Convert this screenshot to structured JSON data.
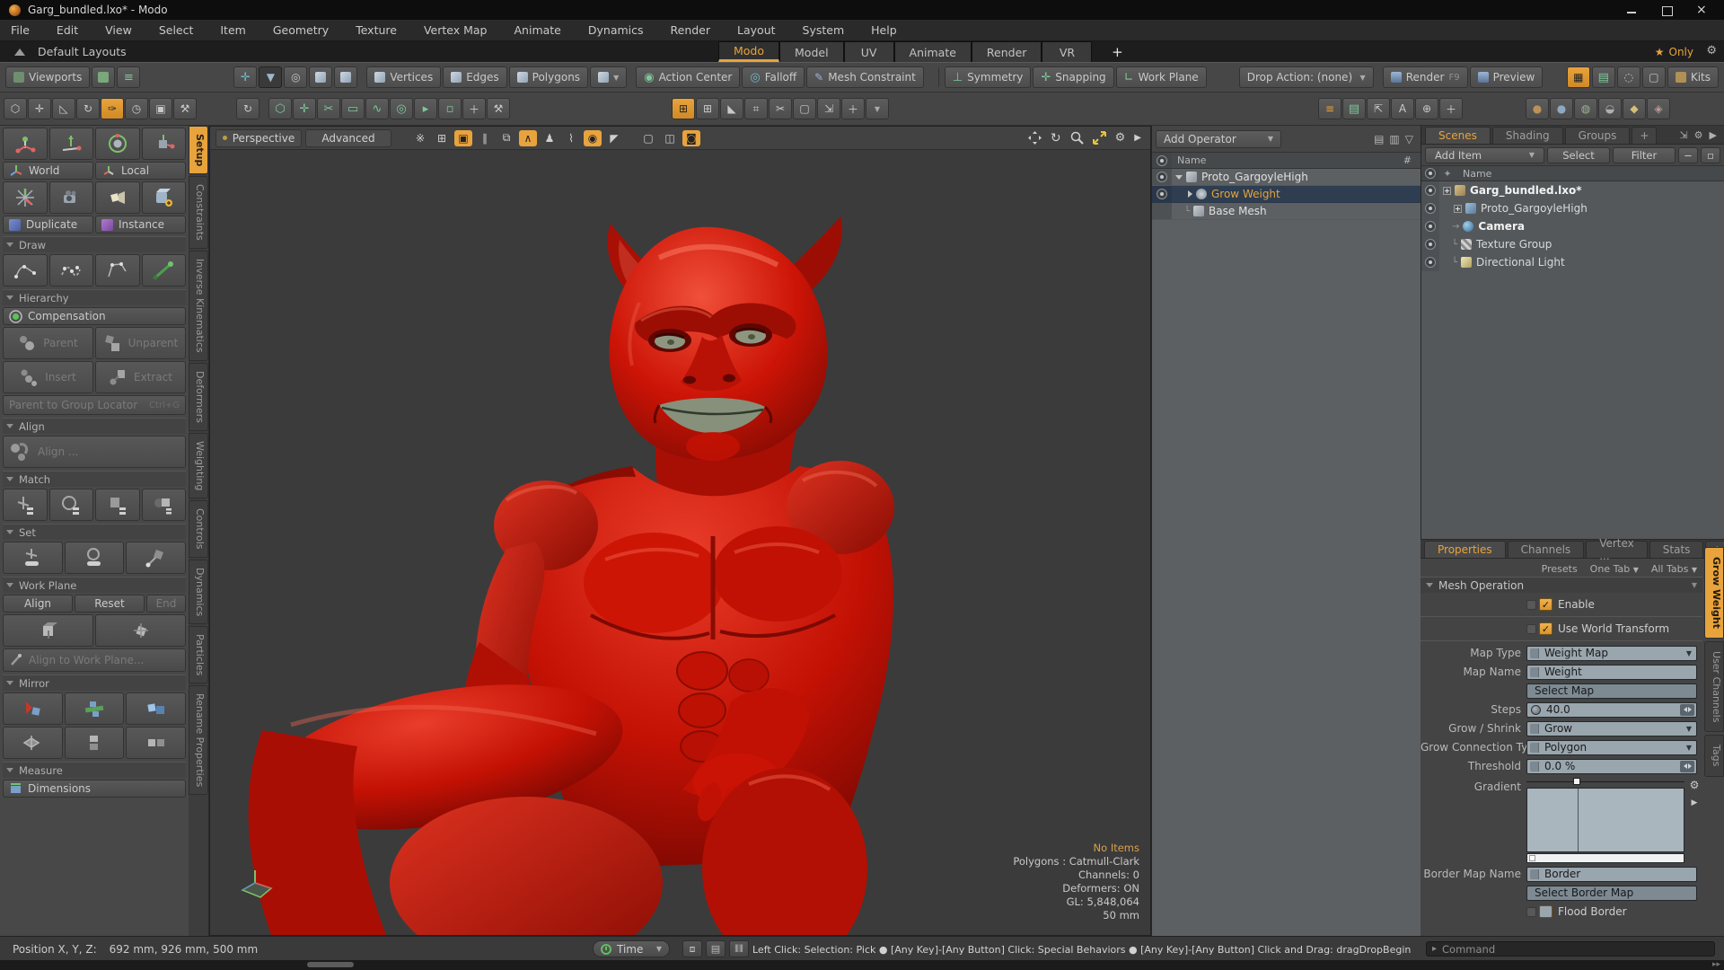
{
  "window": {
    "title": "Garg_bundled.lxo* - Modo"
  },
  "menubar": {
    "items": [
      "File",
      "Edit",
      "View",
      "Select",
      "Item",
      "Geometry",
      "Texture",
      "Vertex Map",
      "Animate",
      "Dynamics",
      "Render",
      "Layout",
      "System",
      "Help"
    ]
  },
  "layoutbar": {
    "default_layouts": "Default Layouts",
    "tabs": [
      "Modo",
      "Model",
      "UV",
      "Animate",
      "Render",
      "VR"
    ],
    "add_tab": "+",
    "only": "Only"
  },
  "toolbar": {
    "viewports": "Viewports",
    "vertices": "Vertices",
    "edges": "Edges",
    "polygons": "Polygons",
    "action_center": "Action Center",
    "falloff": "Falloff",
    "mesh_constraint": "Mesh Constraint",
    "symmetry": "Symmetry",
    "snapping": "Snapping",
    "work_plane": "Work Plane",
    "drop_action": "Drop Action: (none)",
    "render": "Render",
    "render_key": "F9",
    "preview": "Preview",
    "kits": "Kits"
  },
  "sidebar": {
    "tabs": [
      "Setup",
      "Constraints",
      "Inverse Kinematics",
      "Deformers",
      "Weighting",
      "Controls",
      "Dynamics",
      "Particles",
      "Rename Properties"
    ],
    "world": "World",
    "local": "Local",
    "duplicate": "Duplicate",
    "instance": "Instance",
    "draw": "Draw",
    "hierarchy": "Hierarchy",
    "compensation": "Compensation",
    "parent": "Parent",
    "unparent": "Unparent",
    "insert": "Insert",
    "extract": "Extract",
    "parent_to_group_locator": "Parent to Group Locator",
    "parent_to_group_key": "Ctrl+G",
    "align_section": "Align",
    "align_button": "Align ...",
    "match": "Match",
    "set": "Set",
    "work_plane": "Work Plane",
    "wp_align": "Align",
    "wp_reset": "Reset",
    "wp_end": "End",
    "align_to_work_plane": "Align to Work Plane...",
    "mirror": "Mirror",
    "measure": "Measure",
    "dimensions": "Dimensions"
  },
  "viewport": {
    "tab_perspective": "Perspective",
    "tab_advanced": "Advanced",
    "stats": [
      "No Items",
      "Polygons : Catmull-Clark",
      "Channels: 0",
      "Deformers: ON",
      "GL: 5,848,064",
      "50 mm"
    ]
  },
  "meshops": {
    "add_operator": "Add Operator",
    "col_name": "Name",
    "col_num": "#",
    "rows": [
      {
        "label": "Proto_GargoyleHigh"
      },
      {
        "label": "Grow Weight"
      },
      {
        "label": "Base Mesh"
      }
    ]
  },
  "items": {
    "tabs": [
      "Scenes",
      "Shading",
      "Groups"
    ],
    "add_tab": "+",
    "add_item": "Add Item",
    "select": "Select",
    "filter": "Filter",
    "col_name": "Name",
    "rows": [
      {
        "label": "Garg_bundled.lxo*"
      },
      {
        "label": "Proto_GargoyleHigh"
      },
      {
        "label": "Camera"
      },
      {
        "label": "Texture Group"
      },
      {
        "label": "Directional Light"
      }
    ]
  },
  "properties": {
    "tabs": [
      "Properties",
      "Channels",
      "Vertex ...",
      "Stats"
    ],
    "add_tab": "+",
    "presets": "Presets",
    "one_tab": "One Tab",
    "all_tabs": "All Tabs",
    "section": "Mesh Operation",
    "enable": "Enable",
    "use_world_transform": "Use World Transform",
    "map_type_label": "Map Type",
    "map_type_value": "Weight Map",
    "map_name_label": "Map Name",
    "map_name_value": "Weight",
    "select_map": "Select Map",
    "steps_label": "Steps",
    "steps_value": "40.0",
    "grow_shrink_label": "Grow / Shrink",
    "grow_shrink_value": "Grow",
    "grow_connection_label": "Grow Connection Type",
    "grow_connection_value": "Polygon",
    "threshold_label": "Threshold",
    "threshold_value": "0.0 %",
    "gradient_label": "Gradient",
    "border_map_label": "Border Map Name",
    "border_map_value": "Border",
    "select_border_map": "Select Border Map",
    "flood_border": "Flood Border",
    "side_tabs": [
      "Grow Weight",
      "User Channels",
      "Tags"
    ]
  },
  "statusbar": {
    "position_label": "Position X, Y, Z:",
    "position_value": "692 mm, 926 mm, 500 mm",
    "time": "Time",
    "hint": "Left Click: Selection: Pick ● [Any Key]-[Any Button] Click: Special Behaviors ● [Any Key]-[Any Button] Click and Drag: dragDropBegin",
    "command": "Command"
  }
}
